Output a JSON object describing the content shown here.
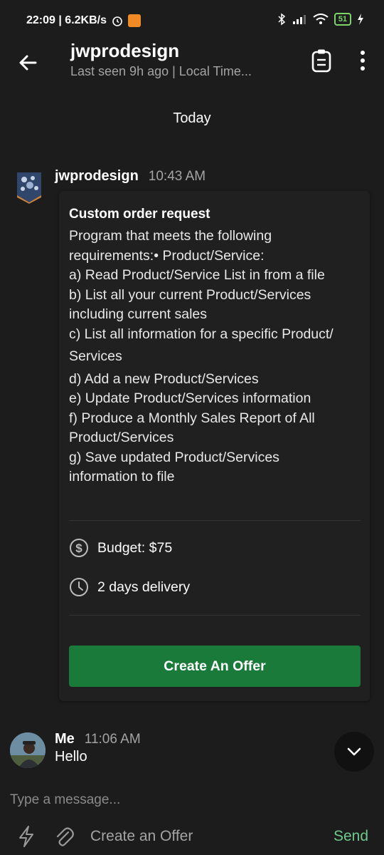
{
  "status_bar": {
    "time_speed": "22:09 | 6.2KB/s",
    "battery": "51"
  },
  "header": {
    "title": "jwprodesign",
    "subtitle": "Last seen 9h ago | Local Time..."
  },
  "divider_label": "Today",
  "messages": [
    {
      "sender": "jwprodesign",
      "time": "10:43 AM",
      "card": {
        "title": "Custom order request",
        "body_lines": [
          "Program that meets the following",
          "requirements:• Product/Service:",
          "a) Read Product/Service List in from a file",
          "b) List all your current Product/Services",
          "including current sales",
          "c) List all information for a specific Product/",
          "Services",
          "d) Add a new Product/Services",
          "e) Update Product/Services information",
          "f) Produce a Monthly Sales Report of All",
          "Product/Services",
          "g) Save updated Product/Services",
          "information to file"
        ],
        "budget": "Budget: $75",
        "delivery": "2 days delivery",
        "button": "Create An Offer"
      }
    },
    {
      "sender": "Me",
      "time": "11:06 AM",
      "text": "Hello"
    }
  ],
  "composer": {
    "placeholder": "Type a message...",
    "create_offer": "Create an Offer",
    "send": "Send"
  },
  "colors": {
    "accent_green": "#197a3a",
    "send_green": "#6fc98a",
    "background": "#1c1c1c"
  }
}
